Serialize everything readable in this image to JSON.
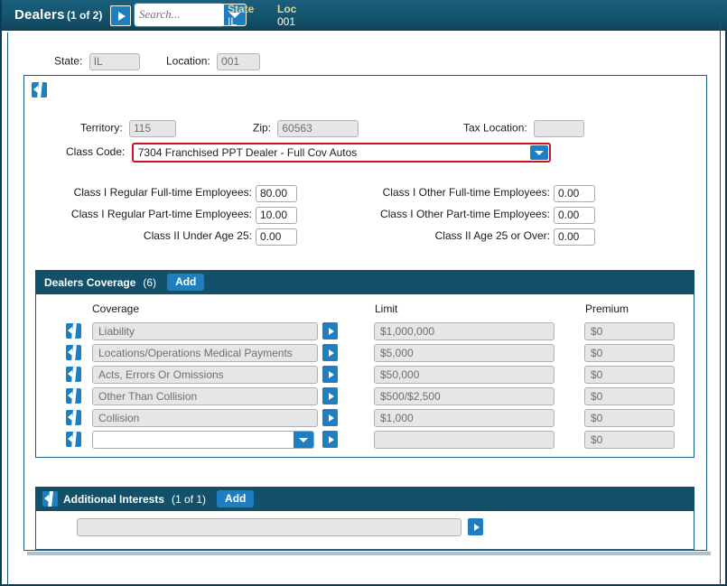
{
  "toolbar": {
    "title": "Dealers",
    "record_count": "(1 of 2)",
    "go_icon": "play-right-icon",
    "search_placeholder": "Search...",
    "search_value": "",
    "dropdown_icon": "chevron-down-icon",
    "fields": [
      {
        "label": "State",
        "value": "IL"
      },
      {
        "label": "Loc",
        "value": "001"
      }
    ],
    "label_color": "#d9d9a0",
    "bg_color": "#15536c"
  },
  "top_fields": {
    "state_label": "State:",
    "state_value": "IL",
    "location_label": "Location:",
    "location_value": "001"
  },
  "panel": {
    "collapse_icon": "book-collapse-icon",
    "territory_label": "Territory:",
    "territory_value": "115",
    "zip_label": "Zip:",
    "zip_value": "60563",
    "tax_location_label": "Tax Location:",
    "tax_location_value": "",
    "class_code_label": "Class Code:",
    "class_code_value": "7304 Franchised PPT Dealer - Full Cov Autos",
    "class_code_error_color": "#cc1122",
    "employees_left": [
      {
        "label": "Class I Regular Full-time Employees:",
        "value": "80.00"
      },
      {
        "label": "Class I Regular Part-time Employees:",
        "value": "10.00"
      },
      {
        "label": "Class II Under Age 25:",
        "value": "0.00"
      }
    ],
    "employees_right": [
      {
        "label": "Class I Other Full-time Employees:",
        "value": "0.00"
      },
      {
        "label": "Class I Other Part-time Employees:",
        "value": "0.00"
      },
      {
        "label": "Class II Age 25 or Over:",
        "value": "0.00"
      }
    ]
  },
  "coverage_section": {
    "title": "Dealers Coverage",
    "count": "(6)",
    "add_label": "Add",
    "columns": {
      "coverage": "Coverage",
      "limit": "Limit",
      "premium": "Premium"
    },
    "rows": [
      {
        "coverage": "Liability",
        "limit": "$1,000,000",
        "premium": "$0",
        "editable": false
      },
      {
        "coverage": "Locations/Operations Medical Payments",
        "limit": "$5,000",
        "premium": "$0",
        "editable": false
      },
      {
        "coverage": "Acts, Errors Or Omissions",
        "limit": "$50,000",
        "premium": "$0",
        "editable": false
      },
      {
        "coverage": "Other Than Collision",
        "limit": "$500/$2,500",
        "premium": "$0",
        "editable": false
      },
      {
        "coverage": "Collision",
        "limit": "$1,000",
        "premium": "$0",
        "editable": false
      },
      {
        "coverage": "",
        "limit": "",
        "premium": "$0",
        "editable": true
      }
    ]
  },
  "additional_interests": {
    "collapse_icon": "book-collapse-icon",
    "title": "Additional Interests",
    "count": "(1 of 1)",
    "add_label": "Add",
    "row_value": ""
  },
  "colors": {
    "header_dark": "#13506a",
    "accent_blue": "#1f7ec0",
    "panel_border": "#1a5f7f",
    "field_disabled": "#e6e6e6"
  }
}
